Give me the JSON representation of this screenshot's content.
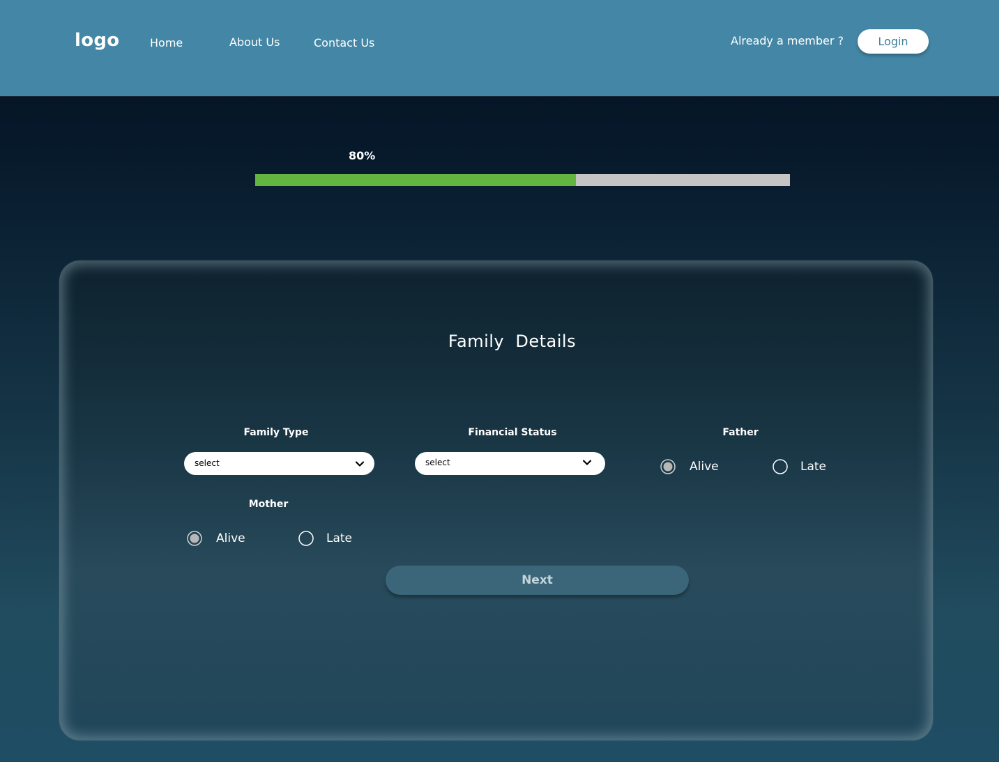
{
  "header": {
    "logo": "logo",
    "nav": {
      "home": "Home",
      "about": "About Us",
      "contact": "Contact Us"
    },
    "member_prompt": "Already a member ?",
    "login_label": "Login"
  },
  "progress": {
    "label": "80%",
    "value": 0.6
  },
  "form": {
    "title": "Family  Details",
    "family_type": {
      "label": "Family Type",
      "value": "select"
    },
    "financial_status": {
      "label": "Financial Status",
      "value": "select"
    },
    "father": {
      "label": "Father",
      "options": [
        "Alive",
        "Late"
      ],
      "selected": "Alive"
    },
    "mother": {
      "label": "Mother",
      "options": [
        "Alive",
        "Late"
      ],
      "selected": "Alive"
    },
    "next_label": "Next"
  },
  "colors": {
    "header_bg": "#4386a5",
    "progress_fill": "#63b53f",
    "progress_track": "#c6c4c4",
    "next_button": "#3b6578",
    "login_text": "#3d7f9e"
  }
}
